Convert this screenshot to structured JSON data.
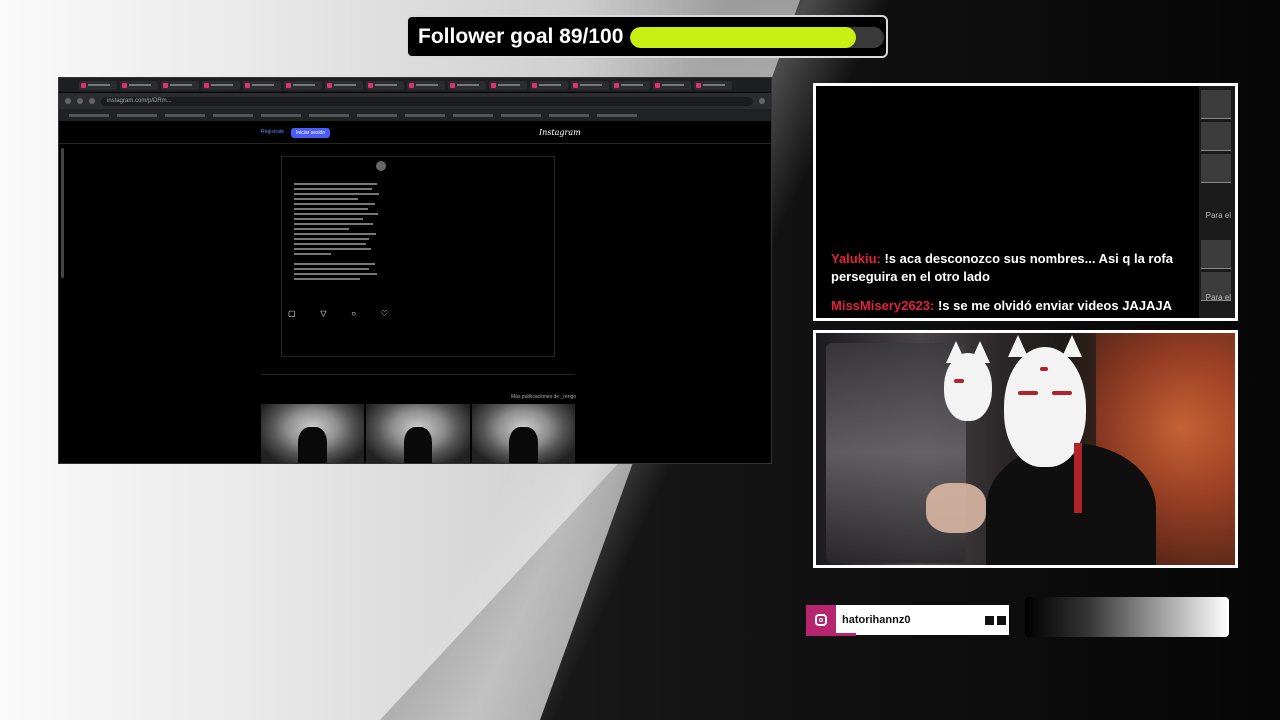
{
  "goal": {
    "label": "Follower goal 89/100",
    "progress": 0.89,
    "color": "#c8f013"
  },
  "browser": {
    "address": "instagram.com/p/DRm...",
    "instagram": {
      "logo": "Instagram",
      "login": "Iniciar sesión",
      "signup": "Regístrate",
      "more_posts": "Más publicaciones de _rengo"
    }
  },
  "chat": {
    "side_labels": [
      "Para el",
      "Para el"
    ],
    "messages": [
      {
        "user": "Yalukiu:",
        "text": " !s aca desconozco sus nombres... Asi q la rofa perseguira en el otro lado"
      },
      {
        "user": "MissMisery2623:",
        "text": " !s se me olvidó enviar videos JAJAJA"
      }
    ],
    "user_color": "#e0233d"
  },
  "social": {
    "handle": "hatorihannz0",
    "icon": "instagram-icon",
    "color": "#b5266e"
  }
}
